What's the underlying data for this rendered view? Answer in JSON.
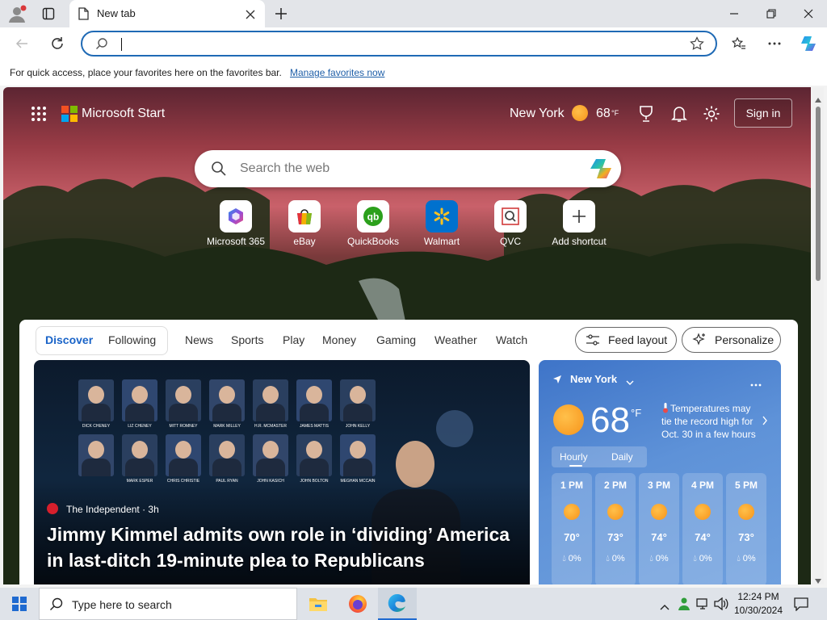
{
  "browser": {
    "tab_title": "New tab",
    "favorites_message": "For quick access, place your favorites here on the favorites bar.",
    "favorites_link": "Manage favorites now",
    "address_value": ""
  },
  "start": {
    "brand": "Microsoft Start",
    "location": "New York",
    "temperature": "68",
    "temperature_unit": "°F",
    "signin_label": "Sign in",
    "search_placeholder": "Search the web"
  },
  "shortcuts": [
    {
      "label": "Microsoft 365"
    },
    {
      "label": "eBay"
    },
    {
      "label": "QuickBooks"
    },
    {
      "label": "Walmart"
    },
    {
      "label": "QVC"
    },
    {
      "label": "Add shortcut"
    }
  ],
  "feed": {
    "nav": [
      "Discover",
      "Following",
      "News",
      "Sports",
      "Play",
      "Money",
      "Gaming",
      "Weather",
      "Watch"
    ],
    "feed_layout_label": "Feed layout",
    "personalize_label": "Personalize",
    "hero": {
      "source": "The Independent · 3h",
      "title": "Jimmy Kimmel admits own role in ‘dividing’ America in last-ditch 19-minute plea to Republicans",
      "faces": [
        "DICK CHENEY",
        "LIZ CHENEY",
        "MITT ROMNEY",
        "MARK MILLEY",
        "H.R. MCMASTER",
        "JAMES MATTIS",
        "JOHN KELLY",
        "",
        "MARK ESPER",
        "CHRIS CHRISTIE",
        "PAUL RYAN",
        "JOHN KASICH",
        "JOHN BOLTON",
        "MEGHAN MCCAIN"
      ]
    }
  },
  "weather": {
    "location": "New York",
    "temp": "68",
    "unit": "°F",
    "alert": "Temperatures may tie the record high for Oct. 30 in a few hours",
    "tabs": [
      "Hourly",
      "Daily"
    ],
    "hourly": [
      {
        "time": "1 PM",
        "temp": "70°",
        "precip": "0%"
      },
      {
        "time": "2 PM",
        "temp": "73°",
        "precip": "0%"
      },
      {
        "time": "3 PM",
        "temp": "74°",
        "precip": "0%"
      },
      {
        "time": "4 PM",
        "temp": "74°",
        "precip": "0%"
      },
      {
        "time": "5 PM",
        "temp": "73°",
        "precip": "0%"
      }
    ]
  },
  "taskbar": {
    "search_placeholder": "Type here to search",
    "time": "12:24 PM",
    "date": "10/30/2024"
  }
}
